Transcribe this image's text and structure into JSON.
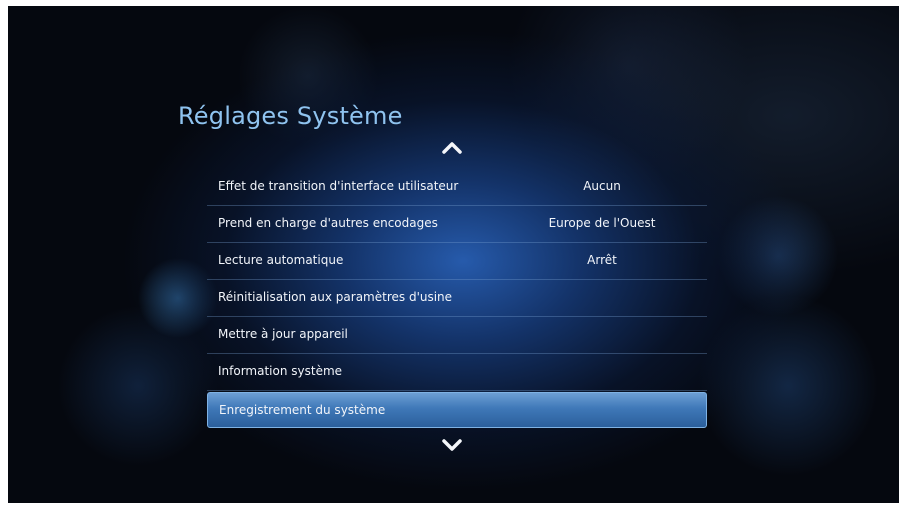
{
  "page_title": "Réglages Système",
  "icons": {
    "scroll_up": "chevron-up-icon",
    "scroll_down": "chevron-down-icon"
  },
  "colors": {
    "title": "#8fc3ef",
    "selection": "#3f78b8"
  },
  "menu": {
    "items": [
      {
        "label": "Effet de transition d'interface utilisateur",
        "value": "Aucun"
      },
      {
        "label": "Prend en charge d'autres encodages",
        "value": "Europe de l'Ouest"
      },
      {
        "label": "Lecture automatique",
        "value": "Arrêt"
      },
      {
        "label": "Réinitialisation aux paramètres d'usine",
        "value": ""
      },
      {
        "label": "Mettre à jour appareil",
        "value": ""
      },
      {
        "label": "Information système",
        "value": ""
      },
      {
        "label": "Enregistrement du système",
        "value": ""
      }
    ],
    "selected_index": 6
  }
}
